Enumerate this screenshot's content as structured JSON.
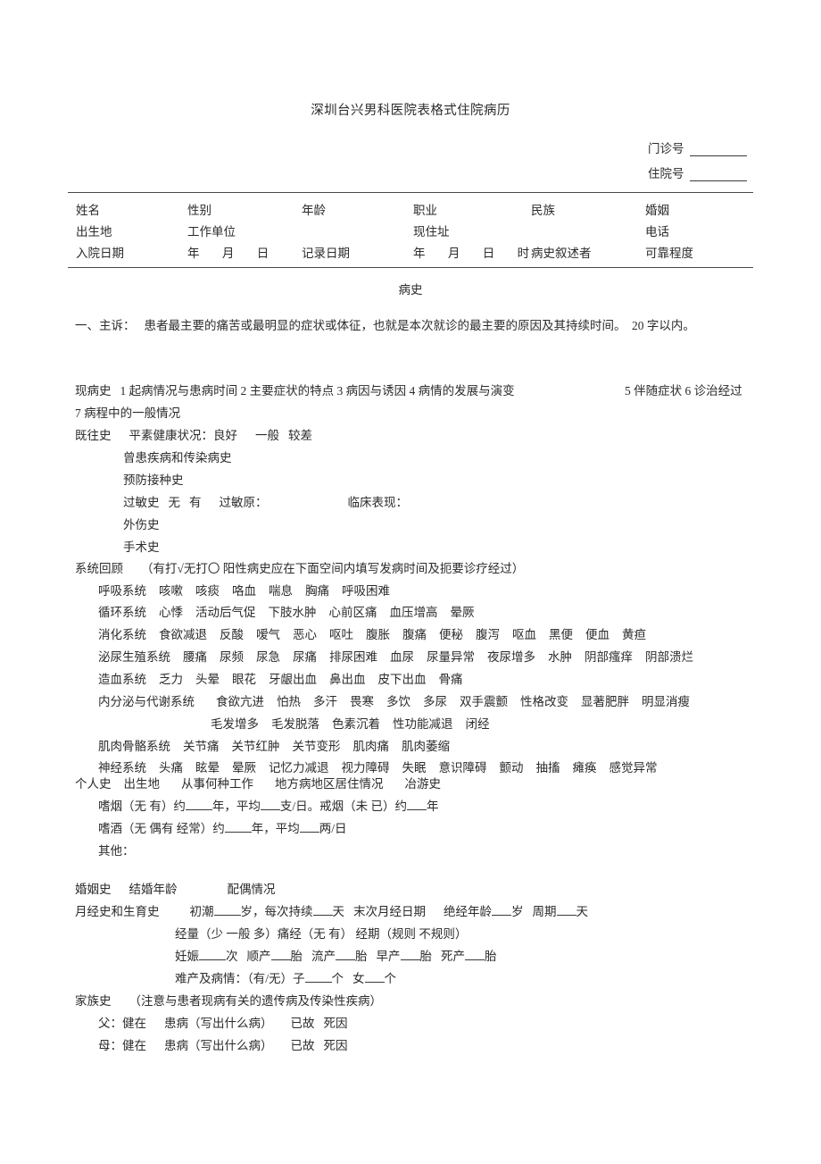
{
  "document": {
    "title": "深圳台兴男科医院表格式住院病历",
    "section_title": "病史"
  },
  "top_numbers": [
    {
      "label": "门诊号"
    },
    {
      "label": "住院号"
    }
  ],
  "identity_table": {
    "row1": [
      {
        "label": "姓名"
      },
      {
        "label": "性别"
      },
      {
        "label": "年龄"
      },
      {
        "label": "职业"
      },
      {
        "label": "民族"
      },
      {
        "label": "婚姻"
      }
    ],
    "row2": [
      {
        "label": "出生地"
      },
      {
        "label": "工作单位"
      },
      {
        "label": "现住址"
      },
      {
        "label": "电话"
      }
    ],
    "row3": [
      {
        "label": "入院日期"
      },
      {
        "label_year": "年",
        "label_month": "月",
        "label_day": "日"
      },
      {
        "label": "记录日期"
      },
      {
        "label_year": "年",
        "label_month": "月",
        "label_day": "日",
        "label_hour": "时"
      },
      {
        "label": "病史叙述者"
      },
      {
        "label": "可靠程度"
      }
    ]
  },
  "chief_complaint": {
    "number": "一、",
    "label": "主诉：",
    "text": "患者最主要的痛苦或最明显的症状或体征，也就是本次就诊的最主要的原因及其持续时间。",
    "limit": "20 字以内。"
  },
  "present_illness": {
    "label": "现病史",
    "items_left": "1 起病情况与患病时间    2 主要症状的特点   3 病因与诱因  4 病情的发展与演变",
    "items_right": "5 伴随症状   6 诊治经过",
    "line2": "7 病程中的一般情况"
  },
  "past_history": {
    "label": "既往史",
    "health_label": "平素健康状况：",
    "health_options": [
      "良好",
      "一般",
      "较差"
    ],
    "lines": [
      "曾患疾病和传染病史",
      "预防接种史"
    ],
    "allergy": {
      "label": "过敏史",
      "no": "无",
      "yes": "有",
      "allergen_label": "过敏原：",
      "clinical_label": "临床表现："
    },
    "trauma": "外伤史",
    "surgery": "手术史"
  },
  "systems_review": {
    "label": "系统回顾",
    "instruction": "（有打√无打〇    阳性病史应在下面空间内填写发病时间及扼要诊疗经过）",
    "systems": [
      {
        "name": "呼吸系统",
        "symptoms": [
          "咳嗽",
          "咳痰",
          "咯血",
          "喘息",
          "胸痛",
          "呼吸困难"
        ]
      },
      {
        "name": "循环系统",
        "symptoms": [
          "心悸",
          "活动后气促",
          "下肢水肿",
          "心前区痛",
          "血压增高",
          "晕厥"
        ]
      },
      {
        "name": "消化系统",
        "symptoms": [
          "食欲减退",
          "反酸",
          "嗳气",
          "恶心",
          "呕吐",
          "腹胀",
          "腹痛",
          "便秘",
          "腹泻",
          "呕血",
          "黑便",
          "便血",
          "黄疸"
        ]
      },
      {
        "name": "泌尿生殖系统",
        "symptoms": [
          "腰痛",
          "尿频",
          "尿急",
          "尿痛",
          "排尿困难",
          "血尿",
          "尿量异常",
          "夜尿增多",
          "水肿",
          "阴部瘙痒",
          "阴部溃烂"
        ]
      },
      {
        "name": "造血系统",
        "symptoms": [
          "乏力",
          "头晕",
          "眼花",
          "牙龈出血",
          "鼻出血",
          "皮下出血",
          "骨痛"
        ]
      },
      {
        "name": "内分泌与代谢系统",
        "symptoms": [
          "食欲亢进",
          "怕热",
          "多汗",
          "畏寒",
          "多饮",
          "多尿",
          "双手震颤",
          "性格改变",
          "显著肥胖",
          "明显消瘦"
        ],
        "symptoms_line2": [
          "毛发增多",
          "毛发脱落",
          "色素沉着",
          "性功能减退",
          "闭经"
        ]
      },
      {
        "name": "肌肉骨骼系统",
        "symptoms": [
          "关节痛",
          "关节红肿",
          "关节变形",
          "肌肉痛",
          "肌肉萎缩"
        ]
      },
      {
        "name": "神经系统",
        "symptoms": [
          "头痛",
          "眩晕",
          "晕厥",
          "记忆力减退",
          "视力障碍",
          "失眠",
          "意识障碍",
          "颤动",
          "抽搐",
          "瘫痪",
          "感觉异常"
        ]
      }
    ]
  },
  "personal_history": {
    "label": "个人史",
    "items": [
      "出生地",
      "从事何种工作",
      "地方病地区居住情况",
      "冶游史"
    ],
    "smoking": {
      "prefix": "嗜烟（无  有）约",
      "years_unit": "年，平均",
      "amount_unit": "支/日。戒烟（未  已）约",
      "quit_unit": "年"
    },
    "drinking": {
      "prefix": "嗜酒（无  偶有  经常）约",
      "years_unit": "年，平均",
      "amount_unit": "两/日"
    },
    "other": "其他："
  },
  "marital_history": {
    "label": "婚姻史",
    "items": [
      "结婚年龄",
      "配偶情况"
    ]
  },
  "menstrual_history": {
    "label": "月经史和生育史",
    "line1": {
      "menarche": "初潮",
      "age_unit": "岁，每次持续",
      "days_unit": "天",
      "last_period": "末次月经日期",
      "menopause": "绝经年龄",
      "menopause_unit": "岁",
      "cycle": "周期",
      "cycle_unit": "天"
    },
    "line2": "经量（少  一般  多）痛经（无    有）     经期（规则    不规则）",
    "line3": {
      "pregnancy": "妊娠",
      "pregnancy_unit": "次",
      "normal_birth": "顺产",
      "normal_unit": "胎",
      "abortion": "流产",
      "abortion_unit": "胎",
      "premature": "早产",
      "premature_unit": "胎",
      "stillbirth": "死产",
      "stillbirth_unit": "胎"
    },
    "line4": {
      "label": "难产及病情：（有/无）子",
      "son_unit": "个",
      "daughter": "女",
      "daughter_unit": "个"
    }
  },
  "family_history": {
    "label": "家族史",
    "note": "（注意与患者现病有关的遗传病及传染性疾病）",
    "father": {
      "label": "父：",
      "alive": "健在",
      "illness": "患病（写出什么病）",
      "deceased": "已故",
      "cause": "死因"
    },
    "mother": {
      "label": "母：",
      "alive": "健在",
      "illness": "患病（写出什么病）",
      "deceased": "已故",
      "cause": "死因"
    }
  }
}
